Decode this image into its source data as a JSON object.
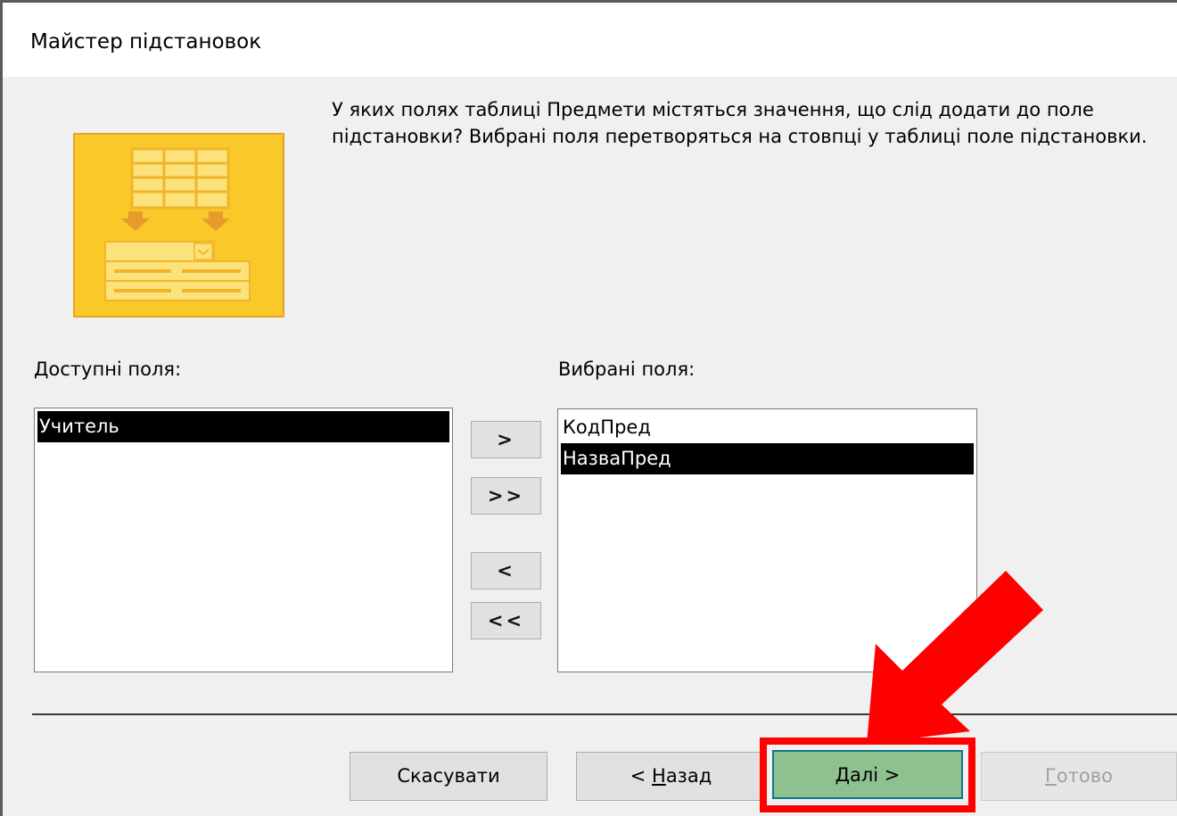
{
  "window": {
    "title": "Майстер підстановок"
  },
  "prompt": {
    "text": "У яких полях таблиці Предмети містяться значення, що слід додати до поле підстановки? Вибрані поля перетворяться на стовпці у таблиці поле підстановки."
  },
  "available_fields": {
    "label": "Доступні поля:",
    "items": [
      {
        "text": "Учитель",
        "selected": true
      }
    ]
  },
  "selected_fields": {
    "label": "Вибрані поля:",
    "items": [
      {
        "text": "КодПред",
        "selected": false
      },
      {
        "text": "НазваПред",
        "selected": true
      }
    ]
  },
  "move_buttons": {
    "add_one": ">",
    "add_all": ">>",
    "remove_one": "<",
    "remove_all": "<<"
  },
  "footer": {
    "cancel": "Скасувати",
    "back_prefix": "< ",
    "back_key": "Н",
    "back_rest": "азад",
    "next_key": "Д",
    "next_rest": "алі >",
    "finish_key": "Г",
    "finish_rest": "отово"
  },
  "colors": {
    "highlight": "#ff0000",
    "next_button": "#8fc08f",
    "wizard_art": "#f8c928"
  },
  "icons": {
    "wizard_art": "lookup-wizard-icon",
    "annotation": "red-arrow-icon"
  }
}
